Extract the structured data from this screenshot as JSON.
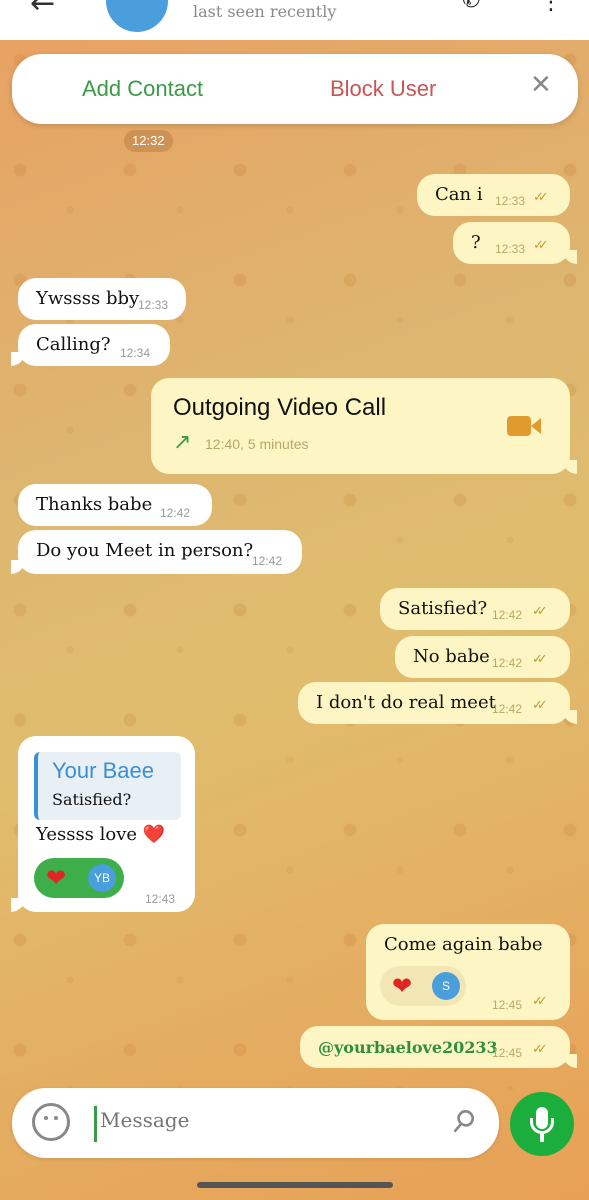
{
  "header": {
    "status": "last seen recently",
    "back_icon": "arrow-left-icon",
    "call_icon": "phone-icon",
    "more_icon": "more-vertical-icon"
  },
  "action_bar": {
    "add_contact": "Add Contact",
    "block_user": "Block User",
    "close": "✕"
  },
  "date_chip": "12:32",
  "messages": [
    {
      "dir": "out",
      "text": "Can i",
      "time": "12:33",
      "read": true
    },
    {
      "dir": "out",
      "text": "?",
      "time": "12:33",
      "read": true
    },
    {
      "dir": "in",
      "text": "Ywssss bby",
      "time": "12:33"
    },
    {
      "dir": "in",
      "text": "Calling?",
      "time": "12:34"
    },
    {
      "dir": "out",
      "type": "call",
      "title": "Outgoing Video Call",
      "meta": "12:40, 5 minutes"
    },
    {
      "dir": "in",
      "text": "Thanks babe",
      "time": "12:42"
    },
    {
      "dir": "in",
      "text": "Do you Meet in person?",
      "time": "12:42"
    },
    {
      "dir": "out",
      "text": "Satisfied?",
      "time": "12:42",
      "read": true
    },
    {
      "dir": "out",
      "text": "No babe",
      "time": "12:42",
      "read": true
    },
    {
      "dir": "out",
      "text": "I don't do real meet",
      "time": "12:42",
      "read": true
    },
    {
      "dir": "in",
      "type": "reply",
      "reply_name": "Your Baee",
      "reply_quote": "Satisfied?",
      "text": "Yessss love ❤️",
      "reaction": "❤",
      "reaction_badge": "YB",
      "time": "12:43"
    },
    {
      "dir": "out",
      "text": "Come again babe",
      "reaction": "❤",
      "reaction_badge": "S",
      "time": "12:45",
      "read": true
    },
    {
      "dir": "out",
      "text": "@yourbaelove20233",
      "time": "12:45",
      "read": true
    }
  ],
  "input": {
    "placeholder": "Message"
  },
  "colors": {
    "outgoing_bubble": "#fdf6c4",
    "incoming_bubble": "#ffffff",
    "accent_green": "#1cae3c",
    "block_red": "#c95454",
    "link_blue": "#3a8fd6"
  }
}
